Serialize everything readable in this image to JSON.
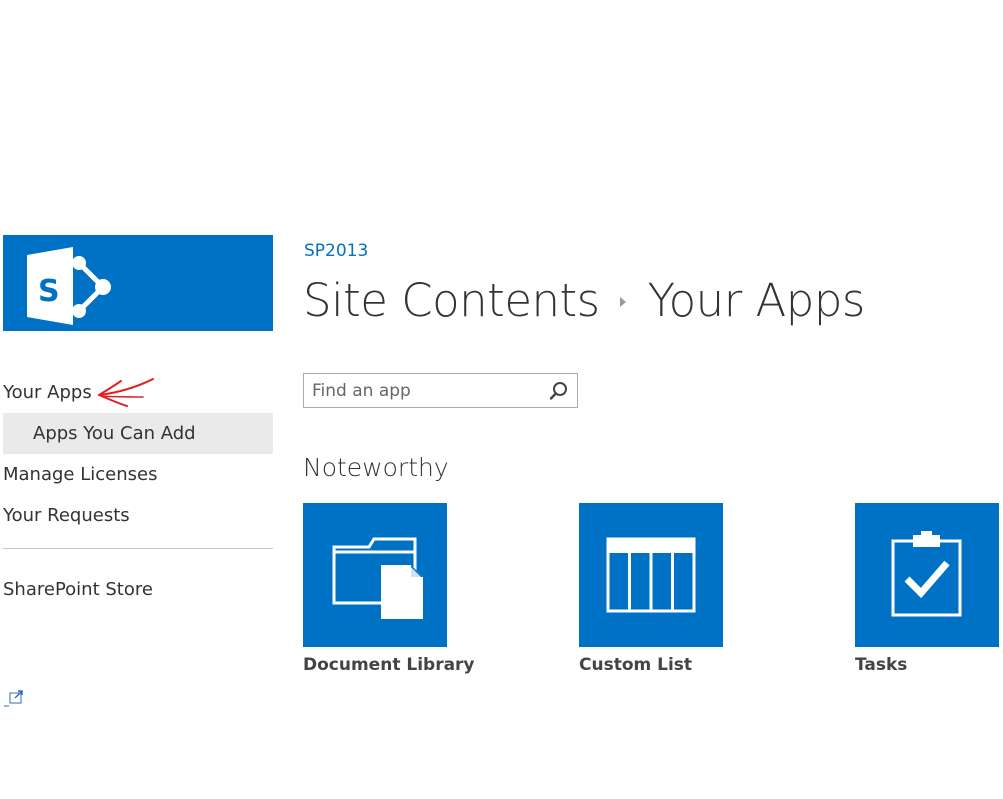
{
  "header": {
    "site_name": "SP2013",
    "title_parent": "Site Contents",
    "title_current": "Your Apps",
    "logo_icon": "sharepoint-logo-icon"
  },
  "left_nav": {
    "items": [
      {
        "label": "Your Apps",
        "selected": false
      },
      {
        "label": "Apps You Can Add",
        "selected": true
      },
      {
        "label": "Manage Licenses",
        "selected": false
      },
      {
        "label": "Your Requests",
        "selected": false
      }
    ],
    "store_label": "SharePoint Store",
    "popout_icon": "popout-icon"
  },
  "search": {
    "placeholder": "Find an app",
    "value": ""
  },
  "noteworthy": {
    "heading": "Noteworthy",
    "tiles": [
      {
        "label": "Document Library",
        "icon": "document-library-icon"
      },
      {
        "label": "Custom List",
        "icon": "custom-list-icon"
      },
      {
        "label": "Tasks",
        "icon": "tasks-icon"
      }
    ]
  },
  "colors": {
    "brand_blue": "#0072c6",
    "annotation_red": "#e02020",
    "selected_bg": "#eaeaea"
  }
}
